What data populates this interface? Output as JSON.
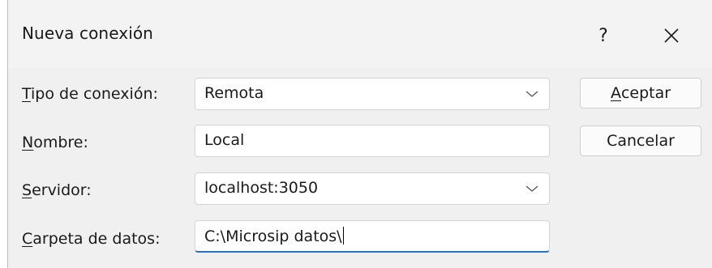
{
  "window": {
    "title": "Nueva conexión",
    "help_label": "?",
    "close_icon": "close-icon"
  },
  "form": {
    "tipo": {
      "label_mnemonic": "T",
      "label_rest": "ipo de conexión:",
      "value": "Remota"
    },
    "nombre": {
      "label_mnemonic": "N",
      "label_rest": "ombre:",
      "value": "Local"
    },
    "servidor": {
      "label_mnemonic": "S",
      "label_rest": "ervidor:",
      "value": "localhost:3050"
    },
    "carpeta": {
      "label_mnemonic": "C",
      "label_rest": "arpeta de datos:",
      "value": "C:\\Microsip datos\\"
    }
  },
  "buttons": {
    "aceptar_mnemonic": "A",
    "aceptar_rest": "ceptar",
    "cancelar": "Cancelar"
  },
  "colors": {
    "focus_underline": "#2b6fbf",
    "dialog_bg": "#f0f0f0"
  }
}
